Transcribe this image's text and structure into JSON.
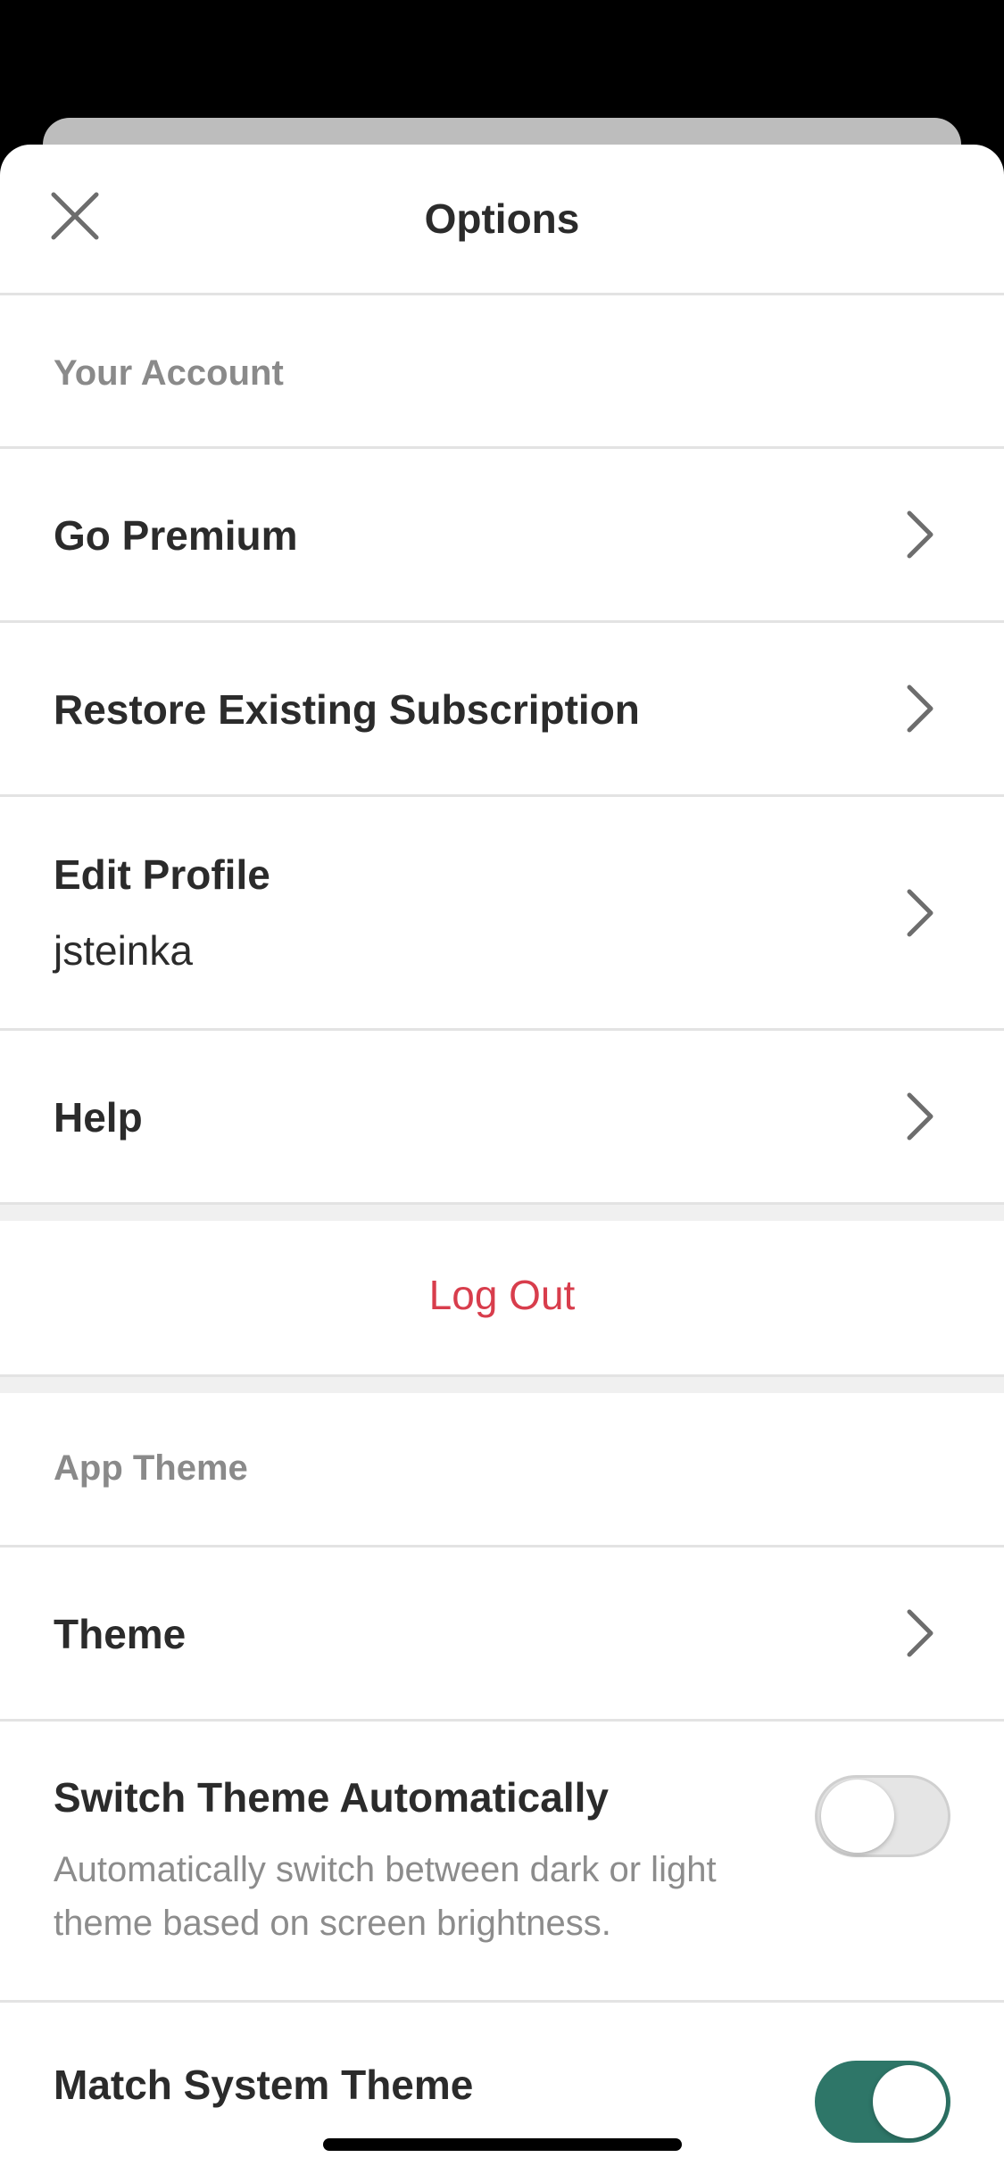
{
  "header": {
    "title": "Options",
    "close_icon": "close-icon"
  },
  "account_section": {
    "header": "Your Account",
    "items": [
      {
        "label": "Go Premium"
      },
      {
        "label": "Restore Existing Subscription"
      },
      {
        "label": "Edit Profile",
        "sublabel": "jsteinka"
      },
      {
        "label": "Help"
      }
    ]
  },
  "logout": {
    "label": "Log Out",
    "color": "#d83d4c"
  },
  "theme_section": {
    "header": "App Theme",
    "theme_item": {
      "label": "Theme"
    },
    "switch_auto": {
      "label": "Switch Theme Automatically",
      "description": "Automatically switch between dark or light theme based on screen brightness.",
      "enabled": false
    },
    "match_system": {
      "label": "Match System Theme",
      "enabled": true
    }
  },
  "colors": {
    "accent": "#2e7668",
    "destructive": "#d83d4c"
  }
}
